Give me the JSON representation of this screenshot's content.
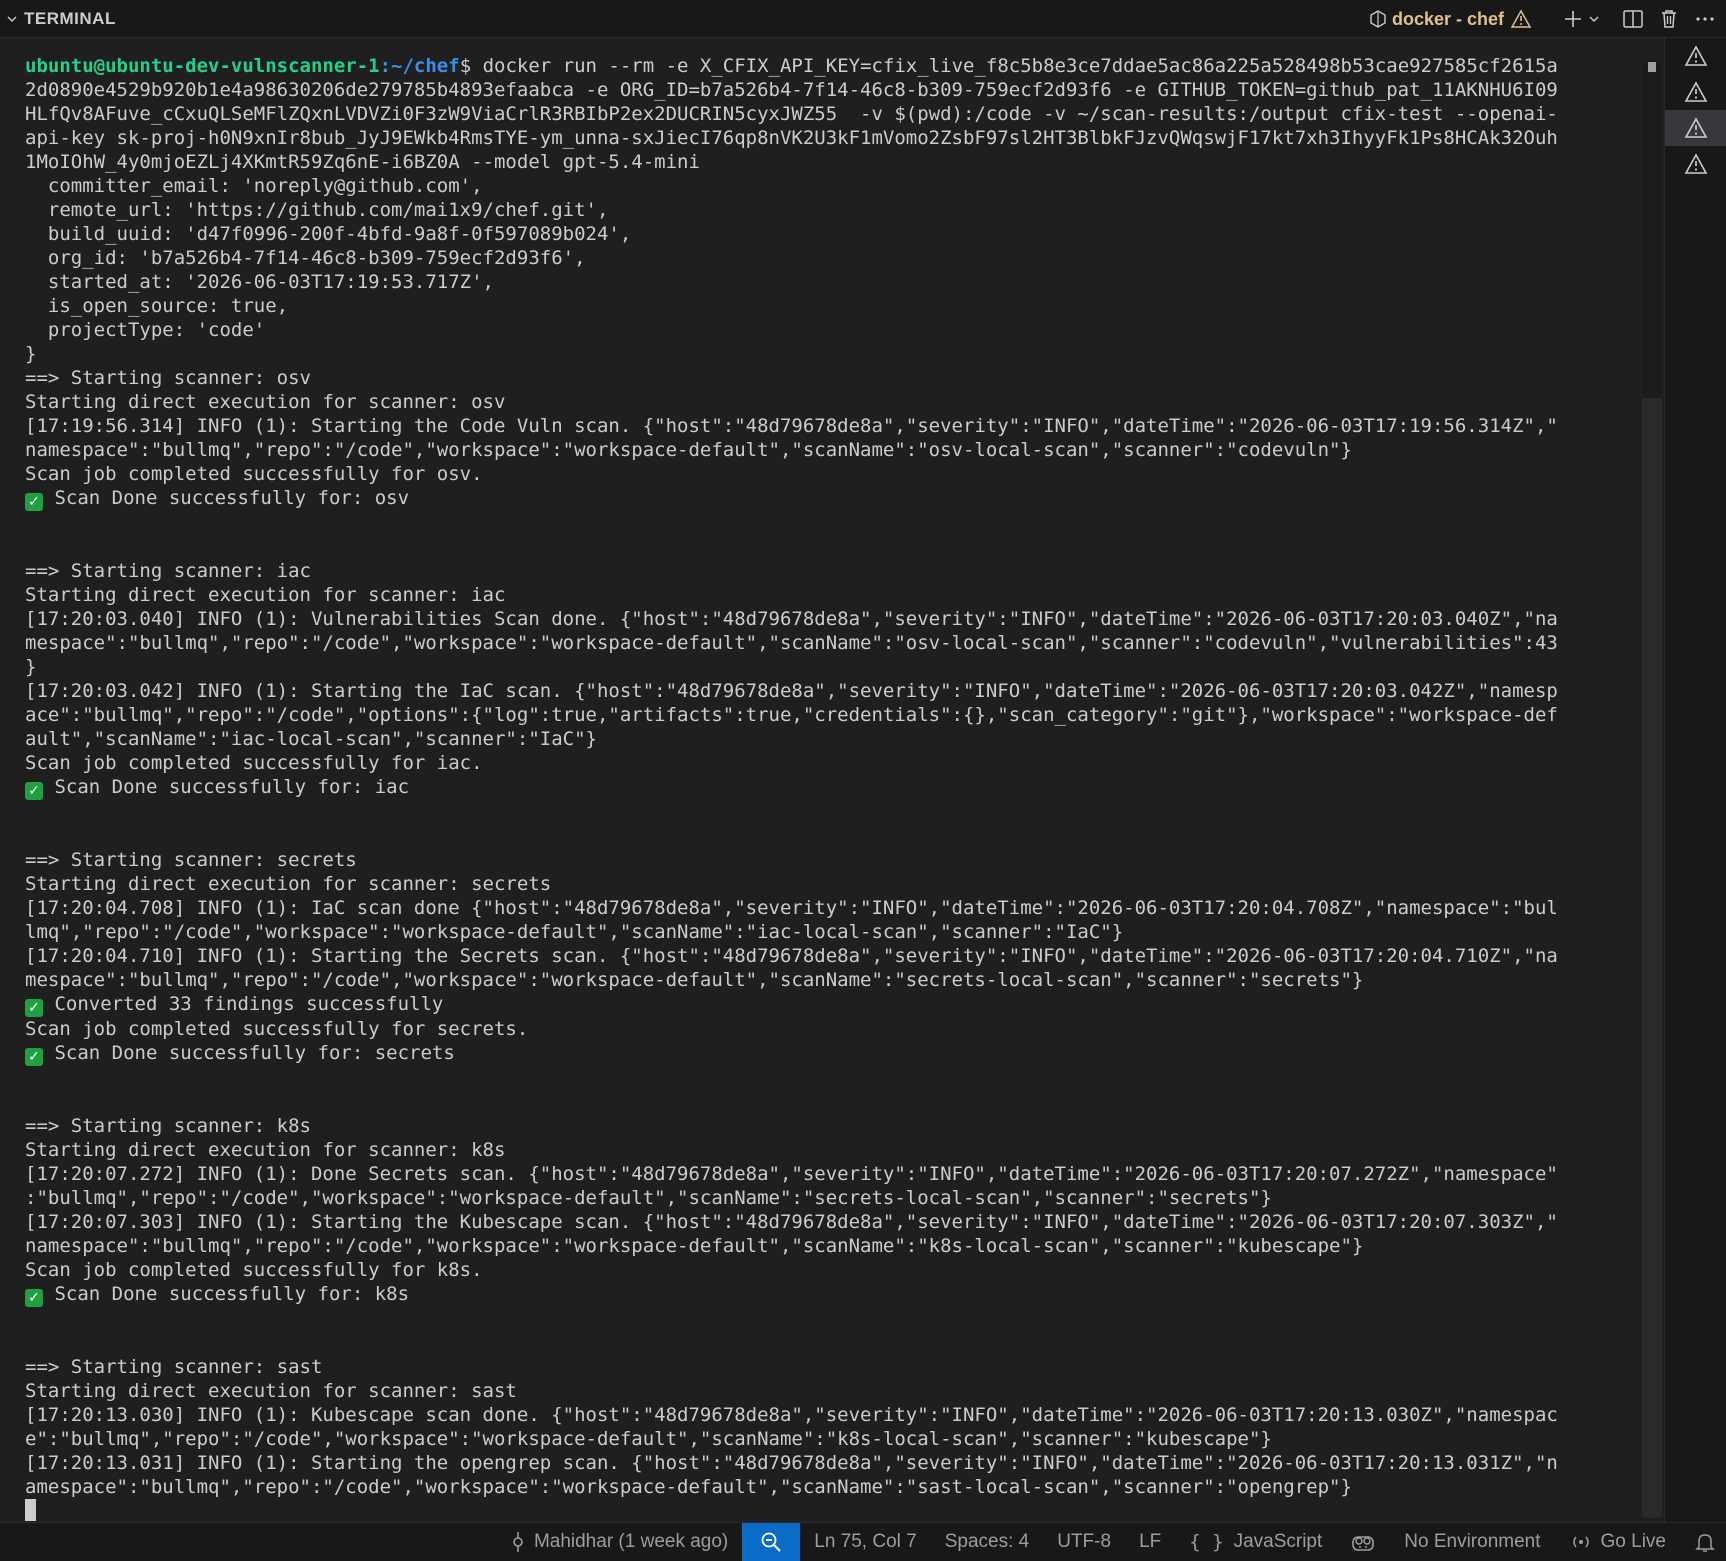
{
  "panel": {
    "title": "TERMINAL",
    "terminal_name": "docker - chef"
  },
  "prompt": {
    "user_host": "ubuntu@ubuntu-dev-vulnscanner-1",
    "path": ":~/chef",
    "symbol": "$"
  },
  "command": " docker run --rm -e X_CFIX_API_KEY=cfix_live_f8c5b8e3ce7ddae5ac86a225a528498b53cae927585cf2615a\n2d0890e4529b920b1e4a98630206de279785b4893efaabca -e ORG_ID=b7a526b4-7f14-46c8-b309-759ecf2d93f6 -e GITHUB_TOKEN=github_pat_11AKNHU6I09\nHLfQv8AFuve_cCxuQLSeMFlZQxnLVDVZi0F3zW9ViaCrlR3RBIbP2ex2DUCRIN5cyxJWZ55  -v $(pwd):/code -v ~/scan-results:/output cfix-test --openai-\napi-key sk-proj-h0N9xnIr8bub_JyJ9EWkb4RmsTYE-ym_unna-sxJiecI76qp8nVK2U3kF1mVomo2ZsbF97sl2HT3BlbkFJzvQWqswjF17kt7xh3IhyyFk1Ps8HCAk32Ouh\n1MoIOhW_4y0mjoEZLj4XKmtR59Zq6nE-i6BZ0A --model gpt-5.4-mini",
  "output": {
    "config_block": "  committer_email: 'noreply@github.com',\n  remote_url: 'https://github.com/mai1x9/chef.git',\n  build_uuid: 'd47f0996-200f-4bfd-9a8f-0f597089b024',\n  org_id: 'b7a526b4-7f14-46c8-b309-759ecf2d93f6',\n  started_at: '2026-06-03T17:19:53.717Z',\n  is_open_source: true,\n  projectType: 'code'\n}",
    "osv_a": "==> Starting scanner: osv\nStarting direct execution for scanner: osv\n[17:19:56.314] INFO (1): Starting the Code Vuln scan. {\"host\":\"48d79678de8a\",\"severity\":\"INFO\",\"dateTime\":\"2026-06-03T17:19:56.314Z\",\"\nnamespace\":\"bullmq\",\"repo\":\"/code\",\"workspace\":\"workspace-default\",\"scanName\":\"osv-local-scan\",\"scanner\":\"codevuln\"}\nScan job completed successfully for osv.",
    "osv_done": " Scan Done successfully for: osv",
    "iac_a": "==> Starting scanner: iac\nStarting direct execution for scanner: iac\n[17:20:03.040] INFO (1): Vulnerabilities Scan done. {\"host\":\"48d79678de8a\",\"severity\":\"INFO\",\"dateTime\":\"2026-06-03T17:20:03.040Z\",\"na\nmespace\":\"bullmq\",\"repo\":\"/code\",\"workspace\":\"workspace-default\",\"scanName\":\"osv-local-scan\",\"scanner\":\"codevuln\",\"vulnerabilities\":43\n}\n[17:20:03.042] INFO (1): Starting the IaC scan. {\"host\":\"48d79678de8a\",\"severity\":\"INFO\",\"dateTime\":\"2026-06-03T17:20:03.042Z\",\"namesp\nace\":\"bullmq\",\"repo\":\"/code\",\"options\":{\"log\":true,\"artifacts\":true,\"credentials\":{},\"scan_category\":\"git\"},\"workspace\":\"workspace-def\nault\",\"scanName\":\"iac-local-scan\",\"scanner\":\"IaC\"}\nScan job completed successfully for iac.",
    "iac_done": " Scan Done successfully for: iac",
    "secrets_a": "==> Starting scanner: secrets\nStarting direct execution for scanner: secrets\n[17:20:04.708] INFO (1): IaC scan done {\"host\":\"48d79678de8a\",\"severity\":\"INFO\",\"dateTime\":\"2026-06-03T17:20:04.708Z\",\"namespace\":\"bul\nlmq\",\"repo\":\"/code\",\"workspace\":\"workspace-default\",\"scanName\":\"iac-local-scan\",\"scanner\":\"IaC\"}\n[17:20:04.710] INFO (1): Starting the Secrets scan. {\"host\":\"48d79678de8a\",\"severity\":\"INFO\",\"dateTime\":\"2026-06-03T17:20:04.710Z\",\"na\nmespace\":\"bullmq\",\"repo\":\"/code\",\"workspace\":\"workspace-default\",\"scanName\":\"secrets-local-scan\",\"scanner\":\"secrets\"}",
    "secrets_converted": " Converted 33 findings successfully",
    "secrets_b": "Scan job completed successfully for secrets.",
    "secrets_done": " Scan Done successfully for: secrets",
    "k8s_a": "==> Starting scanner: k8s\nStarting direct execution for scanner: k8s\n[17:20:07.272] INFO (1): Done Secrets scan. {\"host\":\"48d79678de8a\",\"severity\":\"INFO\",\"dateTime\":\"2026-06-03T17:20:07.272Z\",\"namespace\"\n:\"bullmq\",\"repo\":\"/code\",\"workspace\":\"workspace-default\",\"scanName\":\"secrets-local-scan\",\"scanner\":\"secrets\"}\n[17:20:07.303] INFO (1): Starting the Kubescape scan. {\"host\":\"48d79678de8a\",\"severity\":\"INFO\",\"dateTime\":\"2026-06-03T17:20:07.303Z\",\"\nnamespace\":\"bullmq\",\"repo\":\"/code\",\"workspace\":\"workspace-default\",\"scanName\":\"k8s-local-scan\",\"scanner\":\"kubescape\"}\nScan job completed successfully for k8s.",
    "k8s_done": " Scan Done successfully for: k8s",
    "sast_a": "==> Starting scanner: sast\nStarting direct execution for scanner: sast\n[17:20:13.030] INFO (1): Kubescape scan done. {\"host\":\"48d79678de8a\",\"severity\":\"INFO\",\"dateTime\":\"2026-06-03T17:20:13.030Z\",\"namespac\ne\":\"bullmq\",\"repo\":\"/code\",\"workspace\":\"workspace-default\",\"scanName\":\"k8s-local-scan\",\"scanner\":\"kubescape\"}\n[17:20:13.031] INFO (1): Starting the opengrep scan. {\"host\":\"48d79678de8a\",\"severity\":\"INFO\",\"dateTime\":\"2026-06-03T17:20:13.031Z\",\"n\namespace\":\"bullmq\",\"repo\":\"/code\",\"workspace\":\"workspace-default\",\"scanName\":\"sast-local-scan\",\"scanner\":\"opengrep\"}"
  },
  "statusbar": {
    "blame": "Mahidhar (1 week ago)",
    "position": "Ln 75, Col 7",
    "spaces": "Spaces: 4",
    "encoding": "UTF-8",
    "eol": "LF",
    "language": "JavaScript",
    "environment": "No Environment",
    "golive": "Go Live"
  },
  "colors": {
    "prompt_user": "#23d18b",
    "prompt_path": "#3b8eea",
    "terminal_name": "#e2c08d",
    "status_accent": "#0a6cc7",
    "check": "#21a042"
  },
  "icons": {
    "header": [
      "chevron-down-icon",
      "terminal-icon",
      "warning-icon",
      "plus-icon",
      "split-icon",
      "trash-icon",
      "more-icon"
    ],
    "sidebar": [
      "warning-icon",
      "warning-icon",
      "warning-icon",
      "warning-icon"
    ],
    "status": [
      "git-commit-icon",
      "zoom-icon",
      "braces-icon",
      "copilot-icon",
      "broadcast-icon",
      "bell-icon"
    ]
  }
}
